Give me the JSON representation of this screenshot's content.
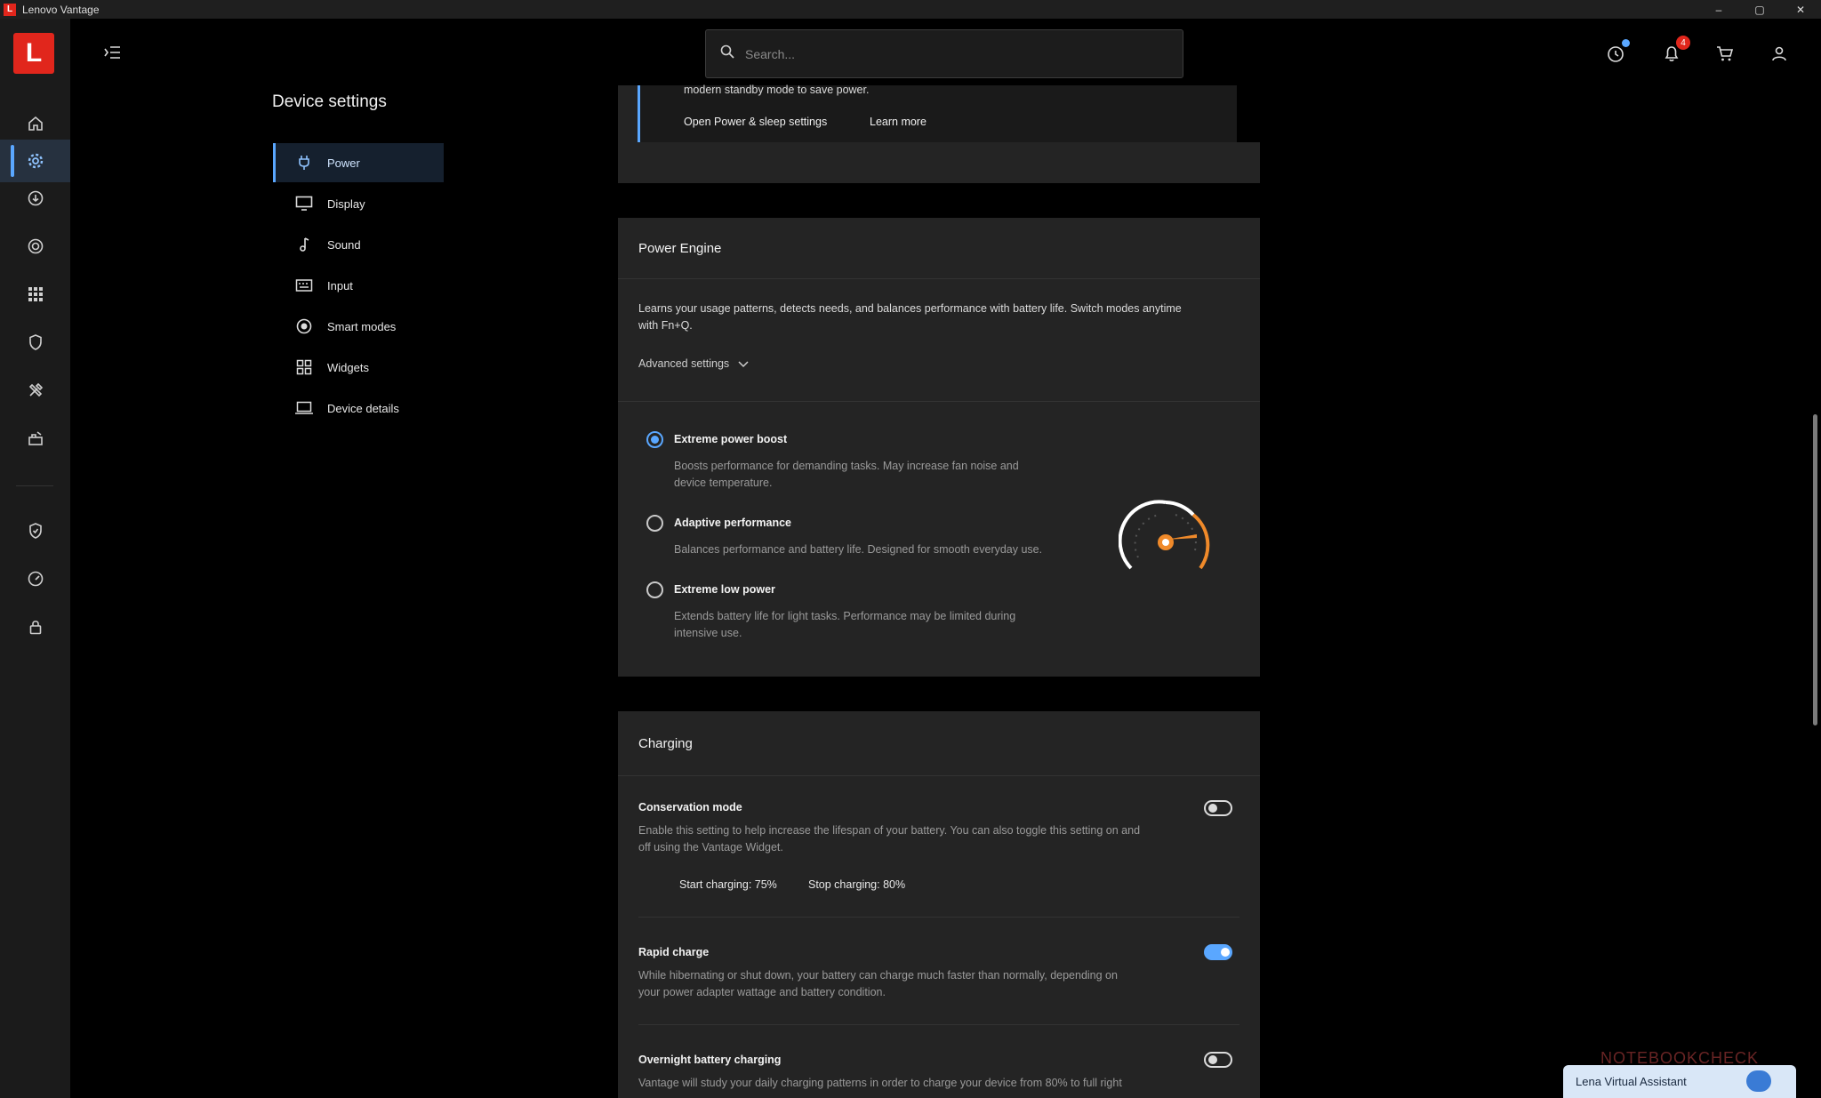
{
  "window": {
    "title": "Lenovo Vantage",
    "controls": [
      "–",
      "▢",
      "✕"
    ]
  },
  "logo": {
    "letter": "L"
  },
  "search": {
    "placeholder": "Search..."
  },
  "header": {
    "notification_count": "4"
  },
  "nav": {
    "title": "Device settings",
    "items": [
      {
        "label": "Power",
        "icon": "plug-icon"
      },
      {
        "label": "Display",
        "icon": "monitor-icon"
      },
      {
        "label": "Sound",
        "icon": "music-note-icon"
      },
      {
        "label": "Input",
        "icon": "keyboard-icon"
      },
      {
        "label": "Smart modes",
        "icon": "target-icon"
      },
      {
        "label": "Widgets",
        "icon": "widgets-icon"
      },
      {
        "label": "Device details",
        "icon": "laptop-icon"
      }
    ]
  },
  "top_card": {
    "text_fragment": "modern standby mode to save power.",
    "link_power_sleep": "Open Power & sleep settings",
    "link_learn_more": "Learn more"
  },
  "power_engine": {
    "title": "Power Engine",
    "description_line1": "Learns your usage patterns, detects needs, and balances performance with battery life. Switch modes anytime",
    "description_line2": "with Fn+Q.",
    "advanced_label": "Advanced settings",
    "modes": [
      {
        "label": "Extreme power boost",
        "desc1": "Boosts performance for demanding tasks. May increase fan noise and",
        "desc2": "device temperature.",
        "selected": true
      },
      {
        "label": "Adaptive performance",
        "desc1": "Balances performance and battery life. Designed for smooth everyday use.",
        "desc2": "",
        "selected": false
      },
      {
        "label": "Extreme low power",
        "desc1": "Extends battery life for light tasks. Performance may be limited during",
        "desc2": "intensive use.",
        "selected": false
      }
    ]
  },
  "charging": {
    "title": "Charging",
    "conservation": {
      "label": "Conservation mode",
      "desc1": "Enable this setting to help increase the lifespan of your battery. You can also toggle this setting on and",
      "desc2": "off using the Vantage Widget.",
      "start": "Start charging: 75%",
      "stop": "Stop charging: 80%",
      "enabled": false
    },
    "rapid": {
      "label": "Rapid charge",
      "desc1": "While hibernating or shut down, your battery can charge much faster than normally, depending on",
      "desc2": "your power adapter wattage and battery condition.",
      "enabled": true
    },
    "overnight": {
      "label": "Overnight battery charging",
      "desc1": "Vantage will study your daily charging patterns in order to charge your device from 80% to full right",
      "enabled": false
    }
  },
  "assistant": {
    "label": "Lena Virtual Assistant"
  },
  "watermark": "NOTEBOOKCHECK",
  "colors": {
    "accent": "#5aa7ff",
    "brand": "#e1261c",
    "card": "#242424",
    "gauge": "#f08a2a"
  }
}
